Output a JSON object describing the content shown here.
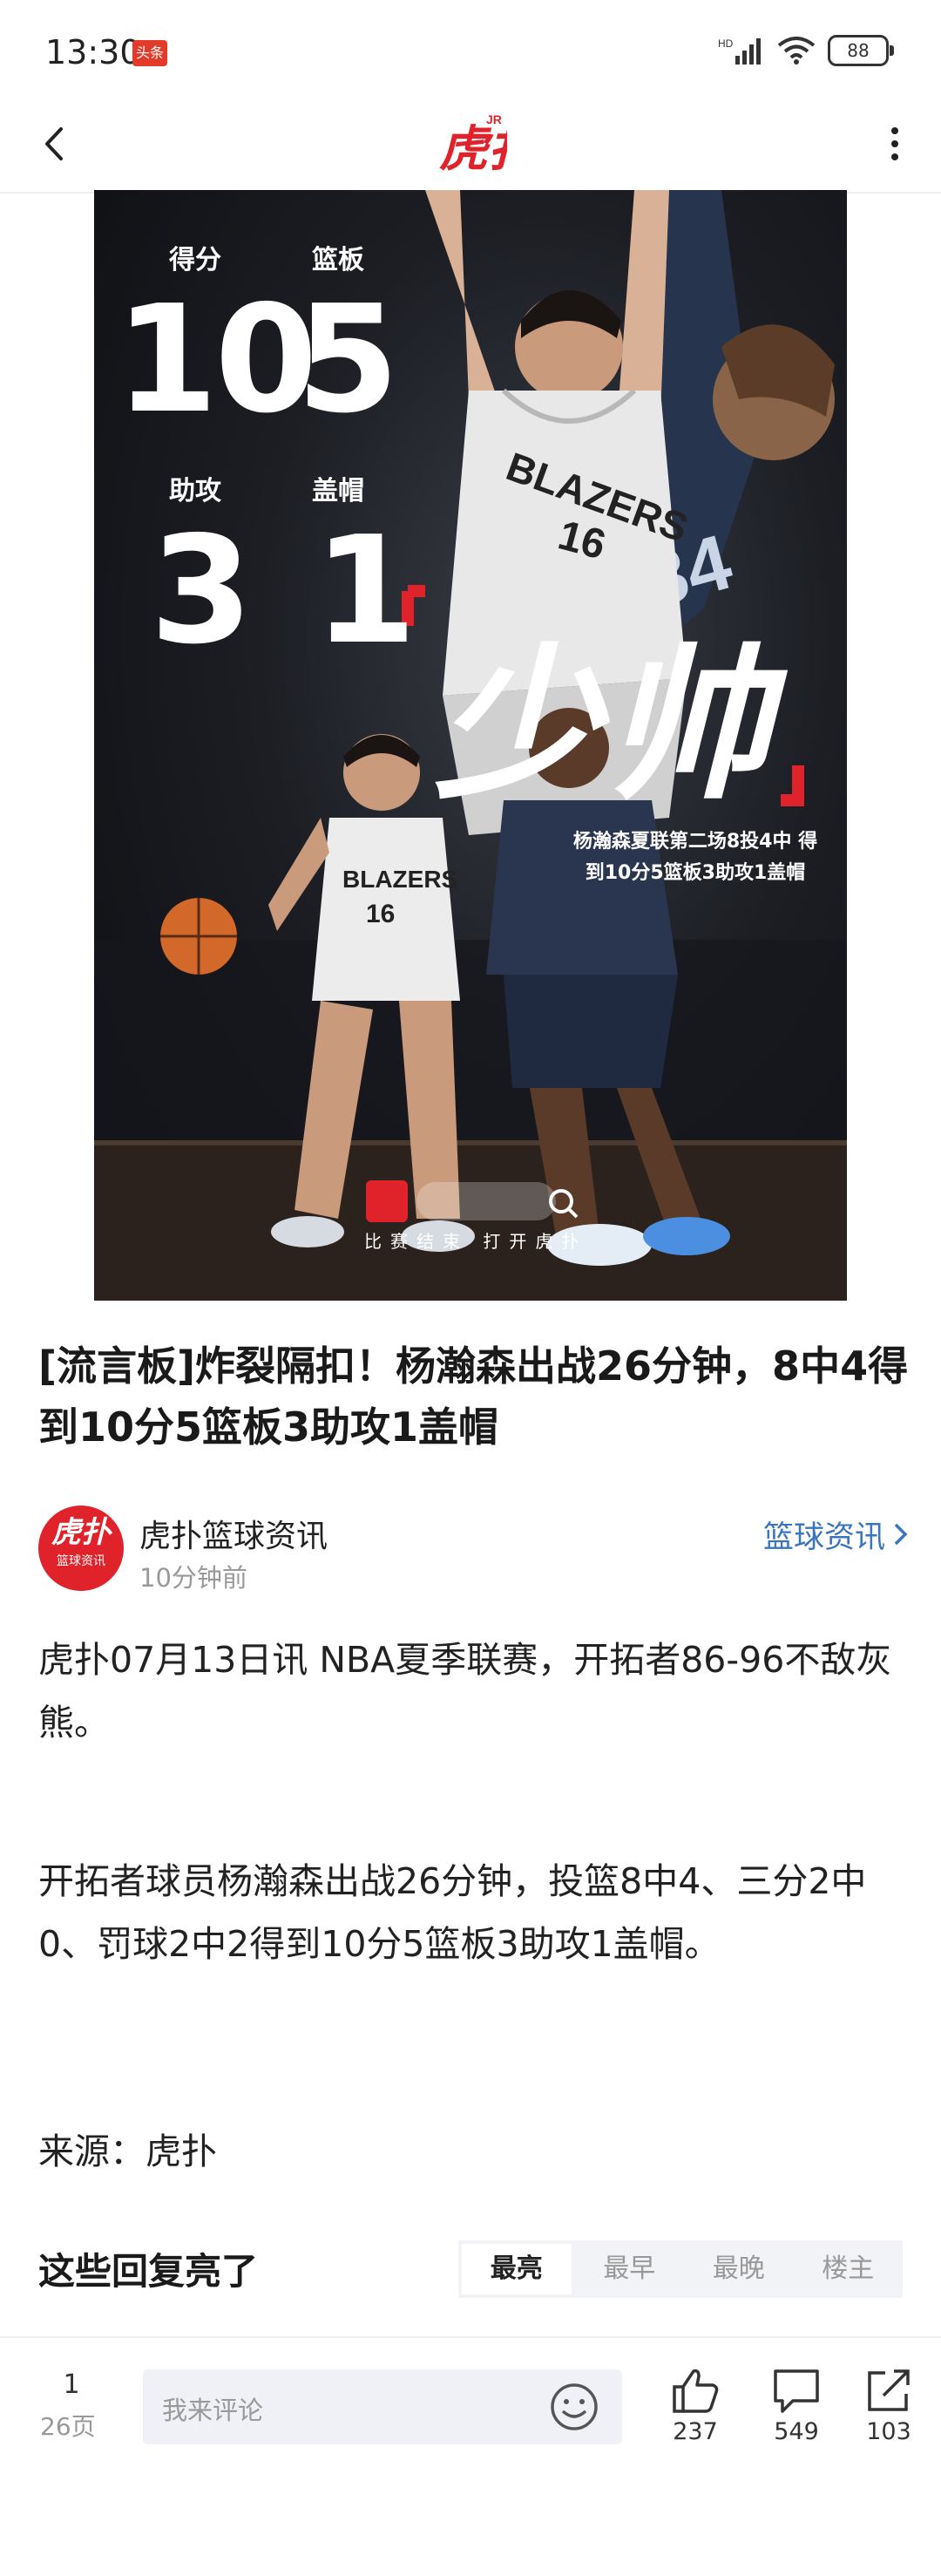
{
  "status_bar": {
    "time": "13:30",
    "app_badge": "头条",
    "network": "HD",
    "battery": "88"
  },
  "nav": {
    "logo_text": "虎扑",
    "logo_sup": "JR"
  },
  "hero": {
    "stats": [
      {
        "label": "得分",
        "value": "10"
      },
      {
        "label": "篮板",
        "value": "5"
      },
      {
        "label": "助攻",
        "value": "3"
      },
      {
        "label": "盖帽",
        "value": "1"
      }
    ],
    "title": "少帅",
    "subtitle": "杨瀚森夏联第二场8投4中 得到10分5篮板3助攻1盖帽",
    "jersey_text": "BLAZERS",
    "jersey_number": "16",
    "bottom_text": "比赛结束  打开虎扑"
  },
  "article": {
    "headline": "[流言板]炸裂隔扣！杨瀚森出战26分钟，8中4得到10分5篮板3助攻1盖帽",
    "author": {
      "name": "虎扑篮球资讯",
      "avatar_big": "虎扑",
      "avatar_small": "篮球资讯",
      "time": "10分钟前"
    },
    "channel": "篮球资讯",
    "paragraphs": [
      "虎扑07月13日讯 NBA夏季联赛，开拓者86-96不敌灰熊。",
      "开拓者球员杨瀚森出战26分钟，投篮8中4、三分2中0、罚球2中2得到10分5篮板3助攻1盖帽。",
      "来源：虎扑"
    ]
  },
  "replies": {
    "title": "这些回复亮了",
    "tabs": [
      "最亮",
      "最早",
      "最晚",
      "楼主"
    ]
  },
  "bottom_bar": {
    "page": "1",
    "total_pages": "26页",
    "comment_placeholder": "我来评论",
    "likes": "237",
    "comments": "549",
    "shares": "103"
  },
  "colors": {
    "brand_red": "#e0222a",
    "link_blue": "#3a76c0"
  }
}
